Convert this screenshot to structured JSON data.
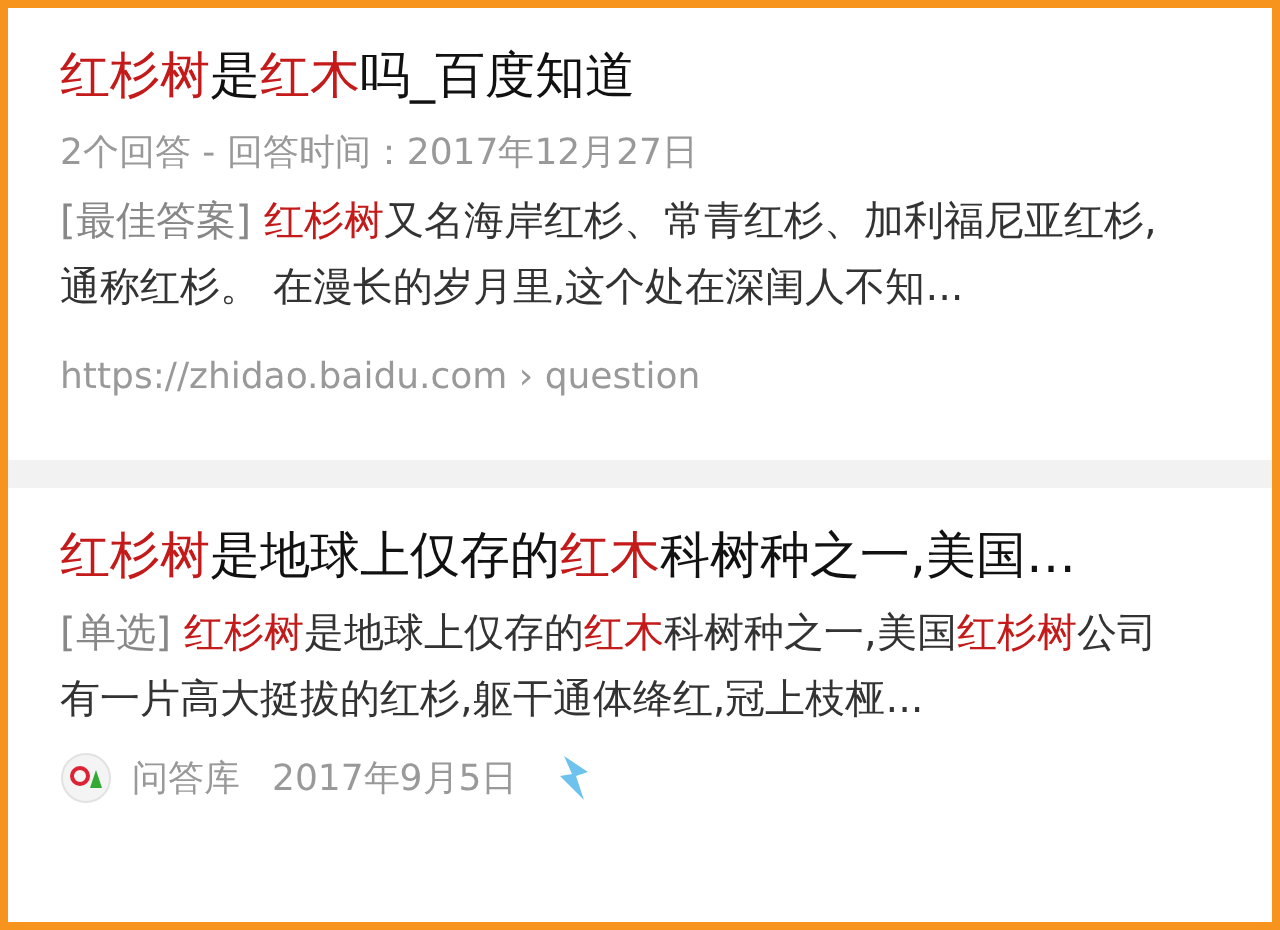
{
  "results": [
    {
      "title": [
        {
          "text": "红杉树",
          "highlight": true
        },
        {
          "text": "是",
          "highlight": false
        },
        {
          "text": "红木",
          "highlight": true
        },
        {
          "text": "吗_百度知道",
          "highlight": false
        }
      ],
      "meta": "2个回答 - 回答时间：2017年12月27日",
      "snippet_tag": "[最佳答案]",
      "snippet": [
        {
          "text": "红杉树",
          "highlight": true
        },
        {
          "text": "又名海岸红杉、常青红杉、加利福尼亚红杉,通称红杉。 在漫长的岁月里,这个处在深闺人不知...",
          "highlight": false
        }
      ],
      "footer": {
        "kind": "url",
        "url": "https://zhidao.baidu.com › question"
      }
    },
    {
      "title": [
        {
          "text": "红杉树",
          "highlight": true
        },
        {
          "text": "是地球上仅存的",
          "highlight": false
        },
        {
          "text": "红木",
          "highlight": true
        },
        {
          "text": "科树种之一,美国…",
          "highlight": false
        }
      ],
      "snippet_tag": "[单选]",
      "snippet": [
        {
          "text": "红杉树",
          "highlight": true
        },
        {
          "text": "是地球上仅存的",
          "highlight": false
        },
        {
          "text": "红木",
          "highlight": true
        },
        {
          "text": "科树种之一,美国",
          "highlight": false
        },
        {
          "text": "红杉树",
          "highlight": true
        },
        {
          "text": "公司有一片高大挺拔的红杉,躯干通体绛红,冠上枝桠...",
          "highlight": false
        }
      ],
      "footer": {
        "kind": "source",
        "source": "问答库",
        "date": "2017年9月5日"
      }
    }
  ]
}
